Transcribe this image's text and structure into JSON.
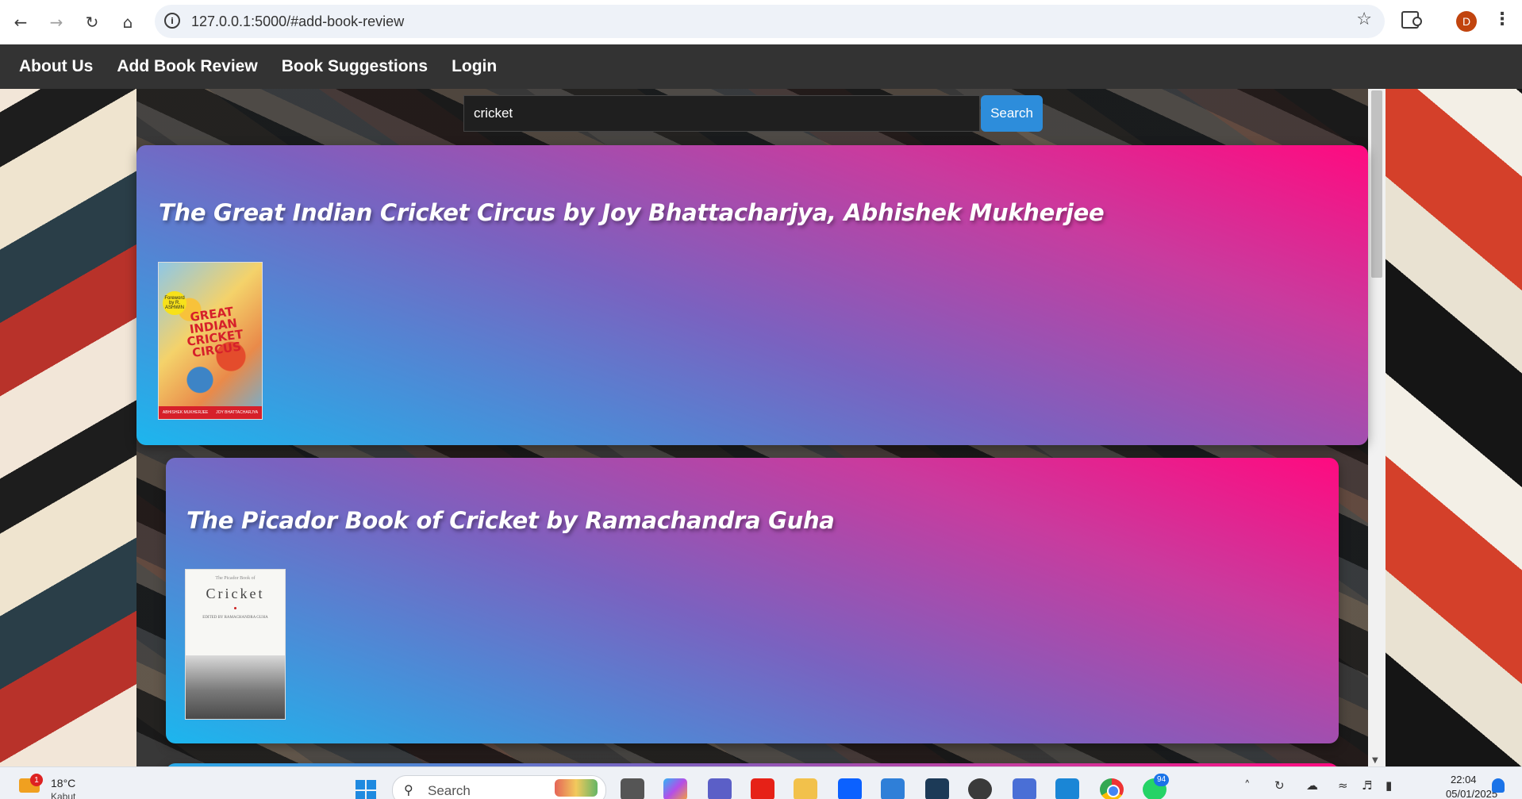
{
  "browser": {
    "url": "127.0.0.1:5000/#add-book-review",
    "avatar_letter": "D",
    "icons": {
      "back": "arrow-left-icon",
      "forward": "arrow-right-icon",
      "reload": "reload-icon",
      "home": "home-icon",
      "site_info": "info-icon",
      "bookmark": "star-icon",
      "extensions": "puzzle-icon",
      "menu": "kebab-menu-icon"
    }
  },
  "nav": {
    "items": [
      {
        "label": "About Us"
      },
      {
        "label": "Add Book Review"
      },
      {
        "label": "Book Suggestions"
      },
      {
        "label": "Login"
      }
    ]
  },
  "search": {
    "value": "cricket",
    "button_label": "Search"
  },
  "results": [
    {
      "title": "The Great Indian Cricket Circus by Joy Bhattacharjya, Abhishek Mukherjee",
      "cover": {
        "title_text": "GREAT INDIAN CRICKET CIRCUS",
        "badge_text": "Foreword by R. ASHWIN",
        "authors_strip": [
          "ABHISHEK MUKHERJEE",
          "JOY BHATTACHARJYA"
        ]
      }
    },
    {
      "title": "The Picador Book of Cricket by Ramachandra Guha",
      "cover": {
        "series_text": "The Picador Book of",
        "title_text": "Cricket",
        "editor_text": "EDITED BY RAMACHANDRA GUHA"
      }
    }
  ],
  "taskbar": {
    "weather_badge": "1",
    "temperature": "18°C",
    "weather_desc": "Kabut",
    "search_label": "Search",
    "whatsapp_badge": "94",
    "time": "22:04",
    "date": "05/01/2025"
  },
  "colors": {
    "nav_bg": "#333333",
    "card_gradient_start": "#1cb6ee",
    "card_gradient_end": "#ff0a80",
    "search_button": "#2d8ddb"
  }
}
